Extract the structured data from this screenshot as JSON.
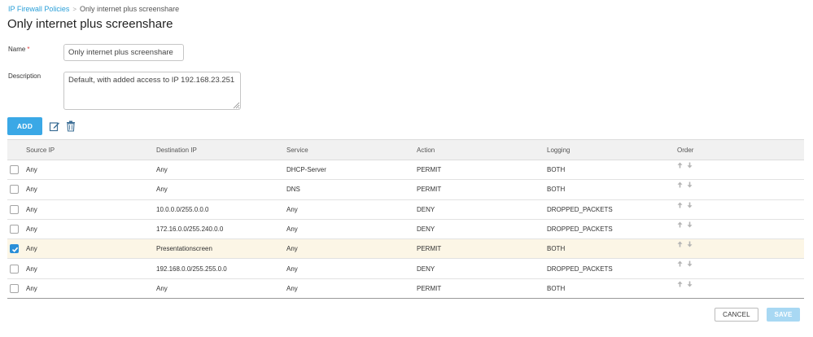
{
  "breadcrumb": {
    "parent": "IP Firewall Policies",
    "separator": ">",
    "current": "Only internet plus screenshare"
  },
  "page_title": "Only internet plus screenshare",
  "form": {
    "name_label": "Name",
    "required_marker": "*",
    "name_value": "Only internet plus screenshare",
    "description_label": "Description",
    "description_value": "Default, with added access to IP 192.168.23.251"
  },
  "toolbar": {
    "add_label": "ADD",
    "edit_icon": "edit-icon",
    "delete_icon": "trash-icon"
  },
  "table": {
    "columns": {
      "source_ip": "Source IP",
      "destination_ip": "Destination IP",
      "service": "Service",
      "action": "Action",
      "logging": "Logging",
      "order": "Order"
    },
    "rows": [
      {
        "source": "Any",
        "destination": "Any",
        "service": "DHCP-Server",
        "action": "PERMIT",
        "logging": "BOTH",
        "selected": false
      },
      {
        "source": "Any",
        "destination": "Any",
        "service": "DNS",
        "action": "PERMIT",
        "logging": "BOTH",
        "selected": false
      },
      {
        "source": "Any",
        "destination": "10.0.0.0/255.0.0.0",
        "service": "Any",
        "action": "DENY",
        "logging": "DROPPED_PACKETS",
        "selected": false
      },
      {
        "source": "Any",
        "destination": "172.16.0.0/255.240.0.0",
        "service": "Any",
        "action": "DENY",
        "logging": "DROPPED_PACKETS",
        "selected": false
      },
      {
        "source": "Any",
        "destination": "Presentationscreen",
        "service": "Any",
        "action": "PERMIT",
        "logging": "BOTH",
        "selected": true
      },
      {
        "source": "Any",
        "destination": "192.168.0.0/255.255.0.0",
        "service": "Any",
        "action": "DENY",
        "logging": "DROPPED_PACKETS",
        "selected": false
      },
      {
        "source": "Any",
        "destination": "Any",
        "service": "Any",
        "action": "PERMIT",
        "logging": "BOTH",
        "selected": false
      }
    ]
  },
  "footer": {
    "cancel_label": "CANCEL",
    "save_label": "SAVE"
  },
  "colors": {
    "accent": "#3aa8e6",
    "link": "#2a9fd8",
    "selected_row": "#fcf6e6",
    "save_disabled": "#a8d8f3",
    "required": "#e04040"
  }
}
